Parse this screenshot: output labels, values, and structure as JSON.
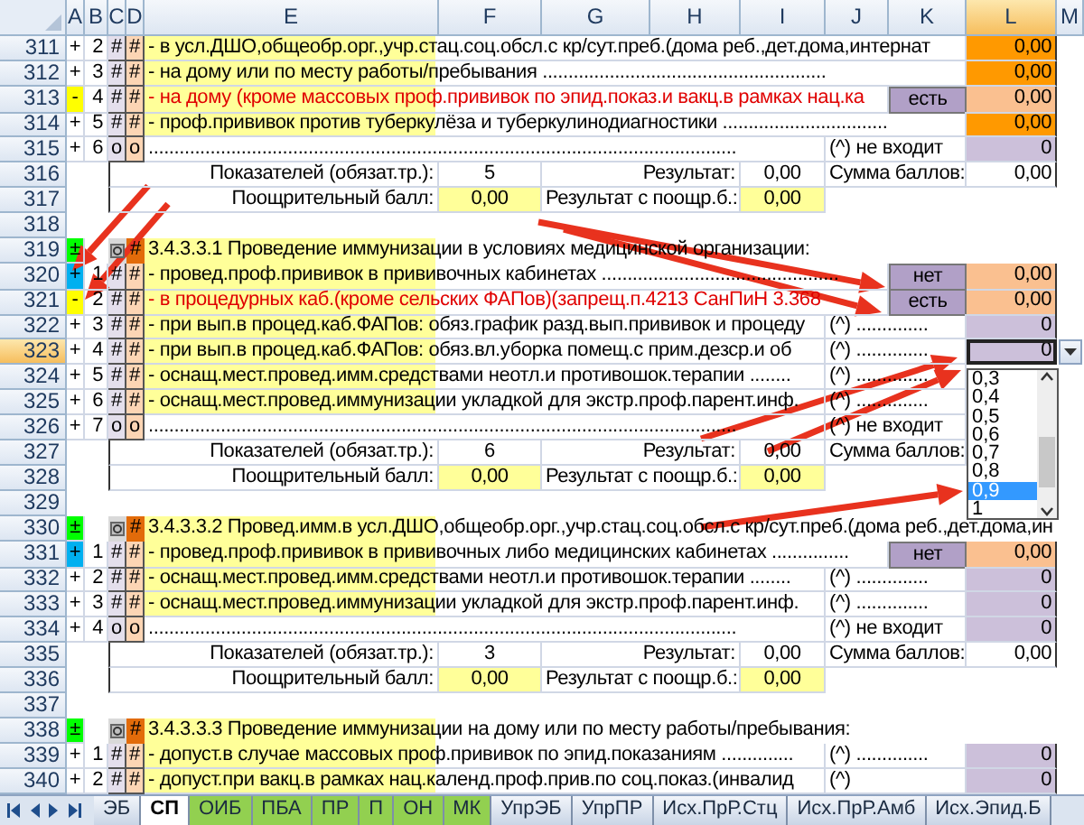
{
  "columns": [
    {
      "label": "A",
      "selected": false
    },
    {
      "label": "B",
      "selected": false
    },
    {
      "label": "C",
      "selected": false
    },
    {
      "label": "D",
      "selected": false
    },
    {
      "label": "E",
      "selected": false
    },
    {
      "label": "F",
      "selected": false
    },
    {
      "label": "G",
      "selected": false
    },
    {
      "label": "H",
      "selected": false
    },
    {
      "label": "I",
      "selected": false
    },
    {
      "label": "J",
      "selected": false
    },
    {
      "label": "K",
      "selected": false
    },
    {
      "label": "L",
      "selected": true
    },
    {
      "label": "M",
      "selected": false
    }
  ],
  "rows": [
    {
      "kind": "item",
      "number": "311",
      "selected": false,
      "marker": {
        "text": "+"
      },
      "index": "2",
      "c": "#",
      "d": "#",
      "text": "- в усл.ДШО,общеобр.орг.,учр.стац.соц.обсл.с кр/сут.преб.(дома реб.,дет.дома,интернат",
      "warning": false,
      "score": {
        "text": "0,00",
        "color": "#ff9900"
      }
    },
    {
      "kind": "item",
      "number": "312",
      "selected": false,
      "marker": {
        "text": "+"
      },
      "index": "3",
      "c": "#",
      "d": "#",
      "text": "- на дому или по месту работы/пребывания .......................................................",
      "warning": false,
      "score": {
        "text": "0,00",
        "color": "#ff9900"
      }
    },
    {
      "kind": "item",
      "number": "313",
      "selected": false,
      "marker": {
        "text": "-",
        "color": "#ffff00"
      },
      "index": "4",
      "c": "#",
      "d": "#",
      "text": "- на дому (кроме массовых проф.прививок по эпид.показ.и вакц.в рамках нац.ка",
      "warning": true,
      "choice": "есть",
      "score": {
        "text": "0,00",
        "color": "#fac090"
      }
    },
    {
      "kind": "item",
      "number": "314",
      "selected": false,
      "marker": {
        "text": "+"
      },
      "index": "5",
      "c": "#",
      "d": "#",
      "text": "- проф.прививок против туберкулёза и туберкулинодиагностики ................................",
      "warning": false,
      "score": {
        "text": "0,00",
        "color": "#ff9900"
      }
    },
    {
      "kind": "dots",
      "number": "315",
      "selected": false,
      "marker": {
        "text": "+"
      },
      "index": "6",
      "c": "o",
      "d": "o",
      "text": "..................................................................................................................",
      "note": "(^) не входит",
      "score": {
        "text": "0",
        "color": "#ccc0da"
      }
    },
    {
      "kind": "total",
      "number": "316",
      "selected": false,
      "label": "Показателей (обязат.тр.):",
      "count": "5",
      "result_label": "Результат:",
      "result": "0,00",
      "sum_label": "Сумма баллов:",
      "sum": "0,00"
    },
    {
      "kind": "bonus",
      "number": "317",
      "selected": false,
      "label": "Поощрительный балл:",
      "bonus": "0,00",
      "result_label": "Результат с поощр.б.:",
      "result": "0,00"
    },
    {
      "kind": "blank",
      "number": "318",
      "selected": false
    },
    {
      "kind": "section",
      "number": "319",
      "selected": false,
      "marker": {
        "text": "±",
        "color": "#00ff00"
      },
      "d": "#",
      "text": "3.4.3.3.1 Проведение иммунизации в условиях медицинской организации:"
    },
    {
      "kind": "item",
      "number": "320",
      "selected": false,
      "marker": {
        "text": "+",
        "color": "#00b0f0"
      },
      "index": "1",
      "c": "#",
      "d": "#",
      "text": "- провед.проф.прививок в прививочных кабинетах ..............................................",
      "warning": false,
      "choice": "нет",
      "score": {
        "text": "0,00",
        "color": "#fac090"
      }
    },
    {
      "kind": "item",
      "number": "321",
      "selected": false,
      "marker": {
        "text": "-",
        "color": "#ffff00"
      },
      "index": "2",
      "c": "#",
      "d": "#",
      "text": "- в процедурных каб.(кроме сельских ФАПов)(запрещ.п.4213 СанПиН 3.368",
      "warning": true,
      "choice": "есть",
      "score": {
        "text": "0,00",
        "color": "#fac090"
      }
    },
    {
      "kind": "item",
      "number": "322",
      "selected": false,
      "marker": {
        "text": "+"
      },
      "index": "3",
      "c": "#",
      "d": "#",
      "text": "- при вып.в процед.каб.ФАПов: обяз.график разд.вып.прививок и процеду",
      "warning": false,
      "note": "(^) ..............",
      "score": {
        "text": "0",
        "color": "#ccc0da"
      }
    },
    {
      "kind": "item",
      "number": "323",
      "selected": true,
      "marker": {
        "text": "+"
      },
      "index": "4",
      "c": "#",
      "d": "#",
      "text": "- при вып.в процед.каб.ФАПов: обяз.вл.уборка помещ.с прим.дезср.и об",
      "warning": false,
      "note": "(^) ..............",
      "score": {
        "text": "0",
        "color": "#ccc0da"
      }
    },
    {
      "kind": "item",
      "number": "324",
      "selected": false,
      "marker": {
        "text": "+"
      },
      "index": "5",
      "c": "#",
      "d": "#",
      "text": "- оснащ.мест.провед.имм.средствами неотл.и противошок.терапии ........",
      "warning": false,
      "note": "(^) .............."
    },
    {
      "kind": "item",
      "number": "325",
      "selected": false,
      "marker": {
        "text": "+"
      },
      "index": "6",
      "c": "#",
      "d": "#",
      "text": "- оснащ.мест.провед.иммунизации укладкой для экстр.проф.парент.инф.",
      "warning": false,
      "note": "(^) .............."
    },
    {
      "kind": "dots",
      "number": "326",
      "selected": false,
      "marker": {
        "text": "+"
      },
      "index": "7",
      "c": "o",
      "d": "o",
      "text": "..................................................................................................................",
      "note": "(^) не входит"
    },
    {
      "kind": "total",
      "number": "327",
      "selected": false,
      "label": "Показателей (обязат.тр.):",
      "count": "6",
      "result_label": "Результат:",
      "result": "0,00",
      "sum_label": "Сумма баллов:"
    },
    {
      "kind": "bonus",
      "number": "328",
      "selected": false,
      "label": "Поощрительный балл:",
      "bonus": "0,00",
      "result_label": "Результат с поощр.б.:",
      "result": "0,00"
    },
    {
      "kind": "blank",
      "number": "329",
      "selected": false
    },
    {
      "kind": "section",
      "number": "330",
      "selected": false,
      "marker": {
        "text": "±",
        "color": "#00ff00"
      },
      "d": "#",
      "text": "3.4.3.3.2 Провед.имм.в усл.ДШО,общеобр.орг.,учр.стац.соц.обсл.с кр/сут.преб.(дома реб.,дет.дома,ин"
    },
    {
      "kind": "item",
      "number": "331",
      "selected": false,
      "marker": {
        "text": "+",
        "color": "#00b0f0"
      },
      "index": "1",
      "c": "#",
      "d": "#",
      "text": "- провед.проф.прививок в прививочных либо медицинских кабинетах ...............",
      "warning": false,
      "choice": "нет",
      "score": {
        "text": "0,00",
        "color": "#fac090"
      }
    },
    {
      "kind": "item",
      "number": "332",
      "selected": false,
      "marker": {
        "text": "+"
      },
      "index": "2",
      "c": "#",
      "d": "#",
      "text": "- оснащ.мест.провед.имм.средствами неотл.и противошок.терапии ........",
      "warning": false,
      "note": "(^) ..............",
      "score": {
        "text": "0",
        "color": "#ccc0da"
      }
    },
    {
      "kind": "item",
      "number": "333",
      "selected": false,
      "marker": {
        "text": "+"
      },
      "index": "3",
      "c": "#",
      "d": "#",
      "text": "- оснащ.мест.провед.иммунизации укладкой для экстр.проф.парент.инф.",
      "warning": false,
      "note": "(^) ..............",
      "score": {
        "text": "0",
        "color": "#ccc0da"
      }
    },
    {
      "kind": "dots",
      "number": "334",
      "selected": false,
      "marker": {
        "text": "+"
      },
      "index": "4",
      "c": "o",
      "d": "o",
      "text": "..................................................................................................................",
      "note": "(^) не входит",
      "score": {
        "text": "0",
        "color": "#ccc0da"
      }
    },
    {
      "kind": "total",
      "number": "335",
      "selected": false,
      "label": "Показателей (обязат.тр.):",
      "count": "3",
      "result_label": "Результат:",
      "result": "0,00",
      "sum_label": "Сумма баллов:",
      "sum": "0,00"
    },
    {
      "kind": "bonus",
      "number": "336",
      "selected": false,
      "label": "Поощрительный балл:",
      "bonus": "0,00",
      "result_label": "Результат с поощр.б.:",
      "result": "0,00"
    },
    {
      "kind": "blank",
      "number": "337",
      "selected": false
    },
    {
      "kind": "section",
      "number": "338",
      "selected": false,
      "marker": {
        "text": "±",
        "color": "#00ff00"
      },
      "d": "#",
      "text": "3.4.3.3.3 Проведение иммунизации на дому или по месту работы/пребывания:"
    },
    {
      "kind": "item",
      "number": "339",
      "selected": false,
      "marker": {
        "text": "+"
      },
      "index": "1",
      "c": "#",
      "d": "#",
      "text": "- допуст.в случае массовых проф.прививок по эпид.показаниям ..............",
      "warning": false,
      "note": "(^) ..............",
      "score": {
        "text": "0",
        "color": "#ccc0da"
      }
    },
    {
      "kind": "item",
      "number": "340",
      "selected": false,
      "marker": {
        "text": "+"
      },
      "index": "2",
      "c": "#",
      "d": "#",
      "text": "- допуст.при вакц.в рамках нац.календ.проф.прив.по соц.показ.(инвалид",
      "warning": false,
      "note": "(^)",
      "score": {
        "text": "0",
        "color": "#ccc0da"
      }
    }
  ],
  "dropdown": {
    "options": [
      {
        "label": "0,3",
        "selected": false
      },
      {
        "label": "0,4",
        "selected": false
      },
      {
        "label": "0,5",
        "selected": false
      },
      {
        "label": "0,6",
        "selected": false
      },
      {
        "label": "0,7",
        "selected": false
      },
      {
        "label": "0,8",
        "selected": false
      },
      {
        "label": "0,9",
        "selected": true
      },
      {
        "label": "1",
        "selected": false
      }
    ]
  },
  "sheet_tabs": [
    {
      "label": "ЭБ",
      "selected": false
    },
    {
      "label": "СП",
      "selected": true
    },
    {
      "label": "ОИБ",
      "selected": false,
      "color": "#92d050"
    },
    {
      "label": "ПБА",
      "selected": false,
      "color": "#92d050"
    },
    {
      "label": "ПР",
      "selected": false,
      "color": "#92d050"
    },
    {
      "label": "П",
      "selected": false,
      "color": "#92d050"
    },
    {
      "label": "ОН",
      "selected": false,
      "color": "#92d050"
    },
    {
      "label": "МК",
      "selected": false,
      "color": "#92d050"
    },
    {
      "label": "УпрЭБ",
      "selected": false
    },
    {
      "label": "УпрПР",
      "selected": false
    },
    {
      "label": "Исх.ПрР.Стц",
      "selected": false
    },
    {
      "label": "Исх.ПрР.Амб",
      "selected": false
    },
    {
      "label": "Исх.Эпид.Б",
      "selected": false
    }
  ]
}
